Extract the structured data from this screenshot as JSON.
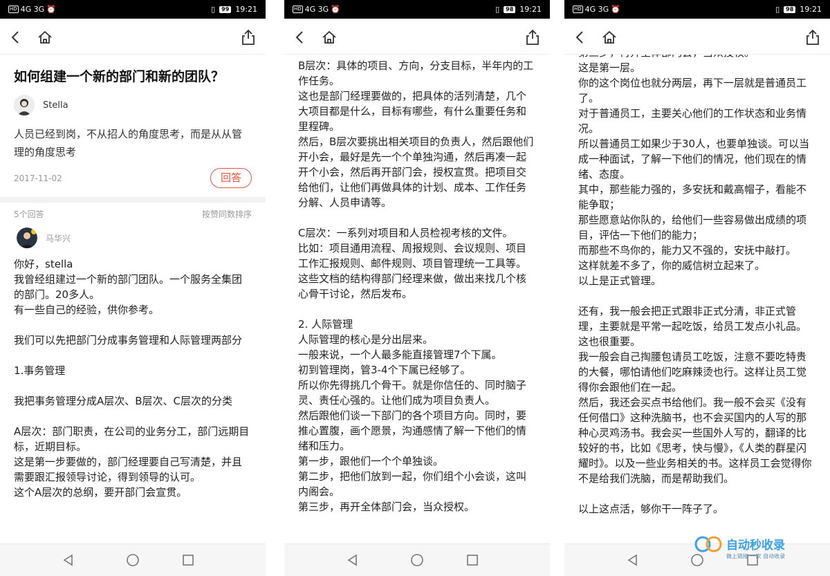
{
  "colors": {
    "accent": "#e8553f",
    "status_bar": "#000000",
    "nav_bar": "#f6f6f6"
  },
  "phones": [
    {
      "status": {
        "time": "19:21",
        "battery": "99",
        "network": "4G 3G"
      },
      "question": {
        "title": "如何组建一个新的部门和新的团队？",
        "author": "Stella",
        "description": "人员已经到岗，不从招人的角度思考，而是从从管理的角度思考",
        "date": "2017-11-02",
        "answer_button": "回答"
      },
      "answers_header": {
        "count": "5个回答",
        "sort": "按赞同数排序"
      },
      "answerer": "马华兴",
      "paragraphs": [
        "你好，stella",
        "我曾经组建过一个新的部门团队。一个服务全集团的部门。20多人。",
        "有一些自己的经验，供你参考。",
        "",
        "我们可以先把部门分成事务管理和人际管理两部分",
        "",
        "1.事务管理",
        "",
        "我把事务管理分成A层次、B层次、C层次的分类",
        "",
        "A层次：部门职责，在公司的业务分工，部门远期目标，近期目标。",
        "这是第一步要做的，部门经理要自己写清楚，并且需要跟汇报领导讨论，得到领导的认可。",
        "这个A层次的总纲，要开部门会宣贯。"
      ]
    },
    {
      "status": {
        "time": "19:21",
        "battery": "98",
        "network": "4G 3G"
      },
      "paragraphs": [
        "B层次：具体的项目、方向，分支目标，半年内的工作任务。",
        "这也是部门经理要做的，把具体的活列清楚，几个大项目都是什么，目标有哪些，有什么重要任务和里程碑。",
        "然后，B层次要挑出相关项目的负责人，然后跟他们开小会，最好是先一个个单独沟通，然后再凑一起开个小会，然后再开部门会，授权宣贯。把项目交给他们，让他们再做具体的计划、成本、工作任务分解、人员申请等。",
        "",
        "C层次：一系列对项目和人员检视考核的文件。",
        "比如：项目通用流程、周报规则、会议规则、项目工作汇报规则、邮件规则、项目管理统一工具等。",
        "这些文档的结构得部门经理来做，做出来找几个核心骨干讨论，然后发布。",
        "",
        "2. 人际管理",
        "人际管理的核心是分出层来。",
        "一般来说，一个人最多能直接管理7个下属。",
        "初到管理岗，管3-4个下属已经够了。",
        "所以你先得挑几个骨干。就是你信任的、同时脑子灵、责任心强的。让他们成为项目负责人。",
        "然后跟他们谈一下部门的各个项目方向。同时，要推心置腹，画个愿景，沟通感情了解一下他们的情绪和压力。",
        "第一步，跟他们一个个单独谈。",
        "第二步，把他们放到一起，你们组个小会谈，这叫内阁会。",
        "第三步，再开全体部门会，当众授权。"
      ]
    },
    {
      "status": {
        "time": "19:21",
        "battery": "98",
        "network": "4G 3G"
      },
      "paragraphs": [
        "第三步，再开全体部门会，当众授权。",
        "这是第一层。",
        "你的这个岗位也就分两层，再下一层就是普通员工了。",
        "对于普通员工，主要关心他们的工作状态和业务情况。",
        "所以普通员工如果少于30人，也要单独谈。可以当成一种面试，了解一下他们的情况，他们现在的情绪、态度。",
        "其中，那些能力强的，多安抚和戴高帽子，看能不能争取；",
        "那些愿意站你队的，给他们一些容易做出成绩的项目，评估一下他们的能力；",
        "而那些不鸟你的，能力又不强的，安抚中敲打。",
        "这样就差不多了，你的威信树立起来了。",
        "以上是正式管理。",
        "",
        "还有，我一般会把正式跟非正式分清，非正式管理，主要就是平常一起吃饭，给员工发点小礼品。这也很重要。",
        "我一般会自己掏腰包请员工吃饭，注意不要吃特贵的大餐，哪怕请他们吃麻辣烫也行。这样让员工觉得你会跟他们在一起。",
        "然后，我还会买点书给他们。我一般不会买《没有任何借口》这种洗脑书，也不会买国内的人写的那种心灵鸡汤书。我会买一些国外人写的，翻译的比较好的书，比如《思考，快与慢》，《人类的群星闪耀时》。以及一些业务相关的书。这样员工会觉得你不是给我们洗脑，而是帮助我们。",
        "",
        "以上这点活，够你干一阵子了。"
      ],
      "watermark": {
        "title": "自动秒收录",
        "subtitle": "做上链接 一次 自动收录"
      }
    }
  ]
}
